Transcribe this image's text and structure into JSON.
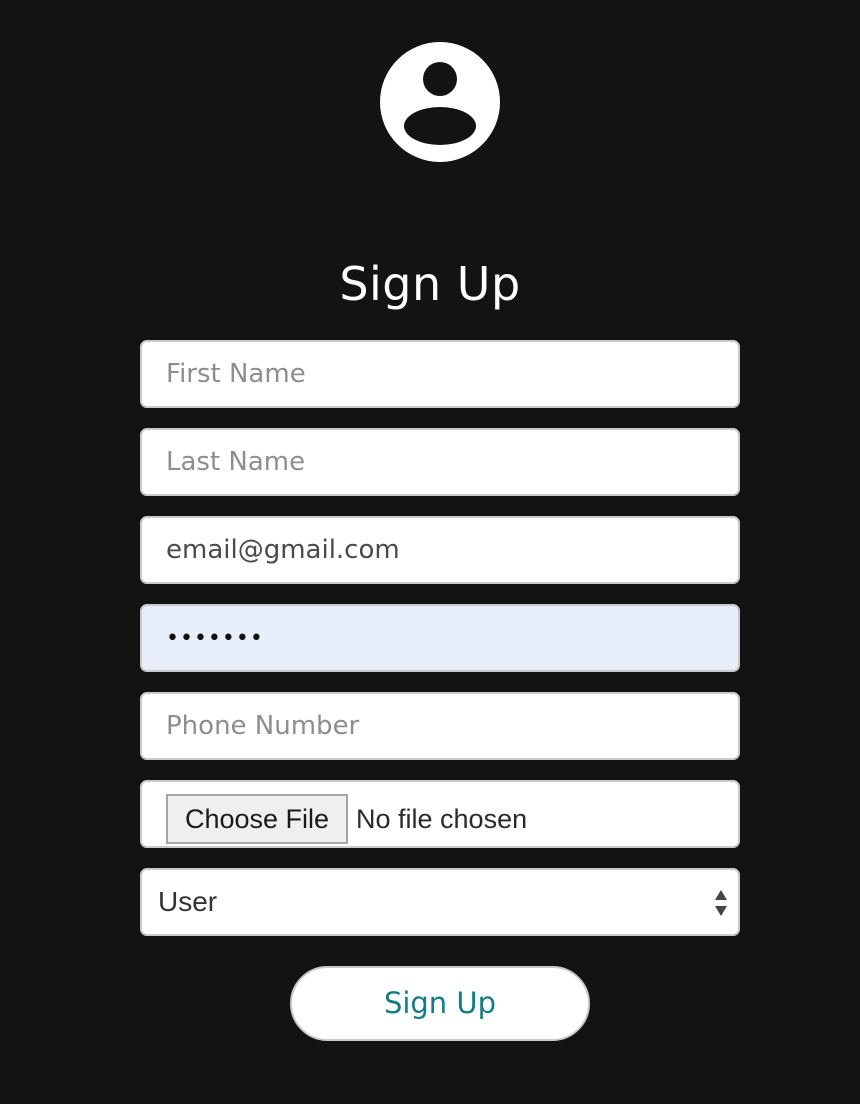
{
  "header": {
    "avatar_icon": "user-circle-icon",
    "title": "Sign Up"
  },
  "form": {
    "first_name": {
      "placeholder": "First Name",
      "value": ""
    },
    "last_name": {
      "placeholder": "Last Name",
      "value": ""
    },
    "email": {
      "placeholder": "",
      "value": "email@gmail.com"
    },
    "password": {
      "value": "1234567",
      "autofilled": true
    },
    "phone": {
      "placeholder": "Phone Number",
      "value": ""
    },
    "file": {
      "button_label": "Choose File",
      "status": "No file chosen"
    },
    "role": {
      "selected": "User"
    },
    "submit_label": "Sign Up"
  },
  "colors": {
    "background": "#131313",
    "title": "#ffffff",
    "submit_text": "#167c82",
    "autofill_bg": "#e8effb"
  }
}
